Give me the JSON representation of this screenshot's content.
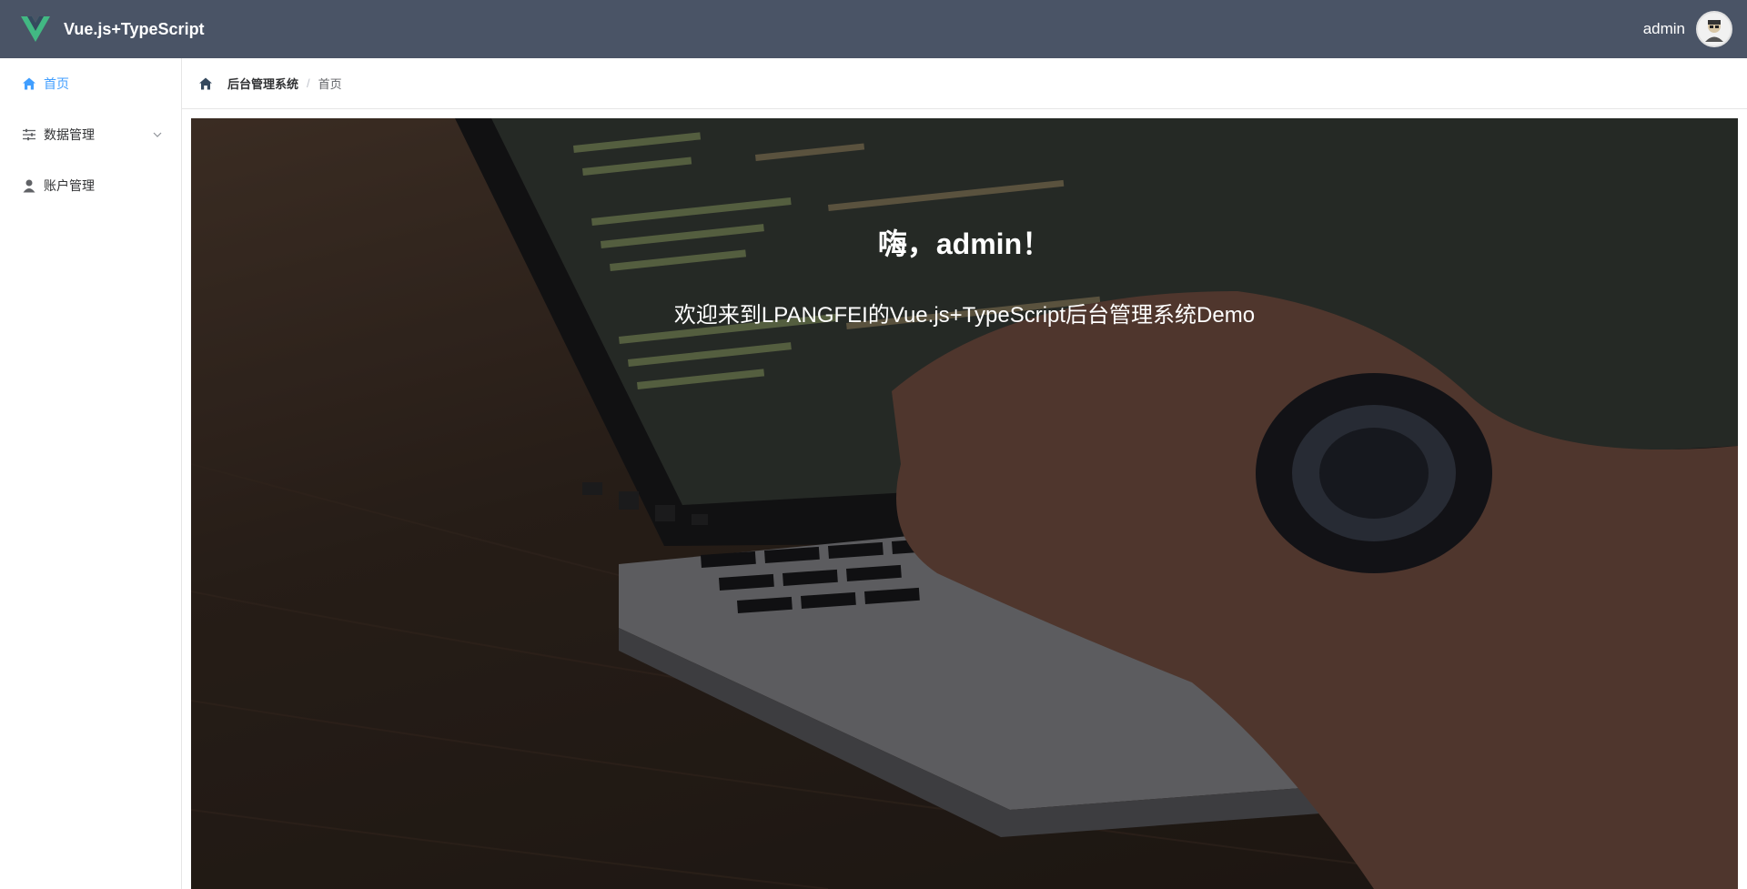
{
  "header": {
    "brand_title": "Vue.js+TypeScript",
    "user_name": "admin"
  },
  "sidebar": {
    "items": [
      {
        "label": "首页",
        "icon": "home-icon",
        "active": true
      },
      {
        "label": "数据管理",
        "icon": "sliders-icon",
        "expandable": true
      },
      {
        "label": "账户管理",
        "icon": "user-icon"
      }
    ]
  },
  "breadcrumb": {
    "root": "后台管理系统",
    "separator": "/",
    "current": "首页"
  },
  "hero": {
    "title": "嗨，admin！",
    "subtitle": "欢迎来到LPANGFEI的Vue.js+TypeScript后台管理系统Demo"
  },
  "colors": {
    "header_bg": "#4a5466",
    "active": "#409eff",
    "vue_green": "#42b883",
    "vue_dark": "#35495e"
  }
}
